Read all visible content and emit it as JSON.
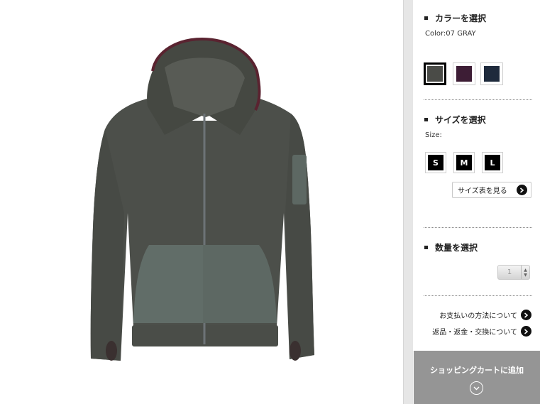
{
  "product": {
    "image_alt": "Gray fleece full-zip hoodie with nylon front pockets"
  },
  "color_section": {
    "heading": "カラーを選択",
    "current_label": "Color:07 GRAY",
    "swatches": [
      {
        "name": "gray",
        "color": "#4a4b47",
        "selected": true
      },
      {
        "name": "wine",
        "color": "#3d1d35",
        "selected": false
      },
      {
        "name": "navy",
        "color": "#1e2a3c",
        "selected": false
      }
    ]
  },
  "size_section": {
    "heading": "サイズを選択",
    "label": "Size:",
    "options": [
      "S",
      "M",
      "L"
    ],
    "chart_link": "サイズ表を見る"
  },
  "quantity_section": {
    "heading": "数量を選択",
    "value": "1",
    "spin_up": "▲",
    "spin_down": "▼"
  },
  "info_links": {
    "payment": "お支払いの方法について",
    "returns": "返品・返金・交換について"
  },
  "cart": {
    "label": "ショッピングカートに追加"
  },
  "colors": {
    "cart_bg": "#959595",
    "scrollbar": "#e6e6e6"
  }
}
